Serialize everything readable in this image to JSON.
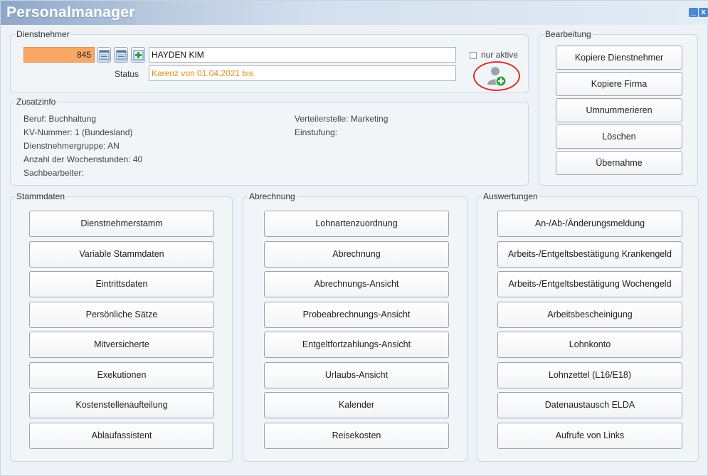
{
  "window": {
    "title": "Personalmanager",
    "minimize_glyph": "_",
    "close_glyph": "x"
  },
  "dienstnehmer": {
    "label": "Dienstnehmer",
    "number": "845",
    "name": "HAYDEN KIM",
    "status_label": "Status",
    "status_value": "Karenz von 01.04.2021 bis",
    "nur_aktive_label": "nur aktive",
    "icons": [
      "list-icon",
      "list-icon",
      "add-plus-icon",
      "add-person-icon"
    ]
  },
  "zusatzinfo": {
    "label": "Zusatzinfo",
    "left": [
      "Beruf: Buchhaltung",
      "KV-Nummer: 1 (Bundesland)",
      "Dienstnehmergruppe: AN",
      "Anzahl der Wochenstunden: 40",
      "Sachbearbeiter:"
    ],
    "right": [
      "Verteilerstelle: Marketing",
      "Einstufung:"
    ]
  },
  "bearbeitung": {
    "label": "Bearbeitung",
    "buttons": [
      "Kopiere Dienstnehmer",
      "Kopiere Firma",
      "Umnummerieren",
      "Löschen",
      "Übernahme"
    ]
  },
  "stammdaten": {
    "label": "Stammdaten",
    "buttons": [
      "Dienstnehmerstamm",
      "Variable Stammdaten",
      "Eintrittsdaten",
      "Persönliche Sätze",
      "Mitversicherte",
      "Exekutionen",
      "Kostenstellenaufteilung",
      "Ablaufassistent"
    ]
  },
  "abrechnung": {
    "label": "Abrechnung",
    "buttons": [
      "Lohnartenzuordnung",
      "Abrechnung",
      "Abrechnungs-Ansicht",
      "Probeabrechnungs-Ansicht",
      "Entgeltfortzahlungs-Ansicht",
      "Urlaubs-Ansicht",
      "Kalender",
      "Reisekosten"
    ]
  },
  "auswertungen": {
    "label": "Auswertungen",
    "buttons": [
      "An-/Ab-/Änderungsmeldung",
      "Arbeits-/Entgeltsbestätigung Krankengeld",
      "Arbeits-/Entgeltsbestätigung Wochengeld",
      "Arbeitsbescheinigung",
      "Lohnkonto",
      "Lohnzettel (L16/E18)",
      "Datenaustausch ELDA",
      "Aufrufe von Links"
    ]
  },
  "colors": {
    "number_field": "#f8a864",
    "status_text": "#e88b1e",
    "highlight_circle": "#d8332e",
    "plus_green": "#2f9e3a"
  }
}
